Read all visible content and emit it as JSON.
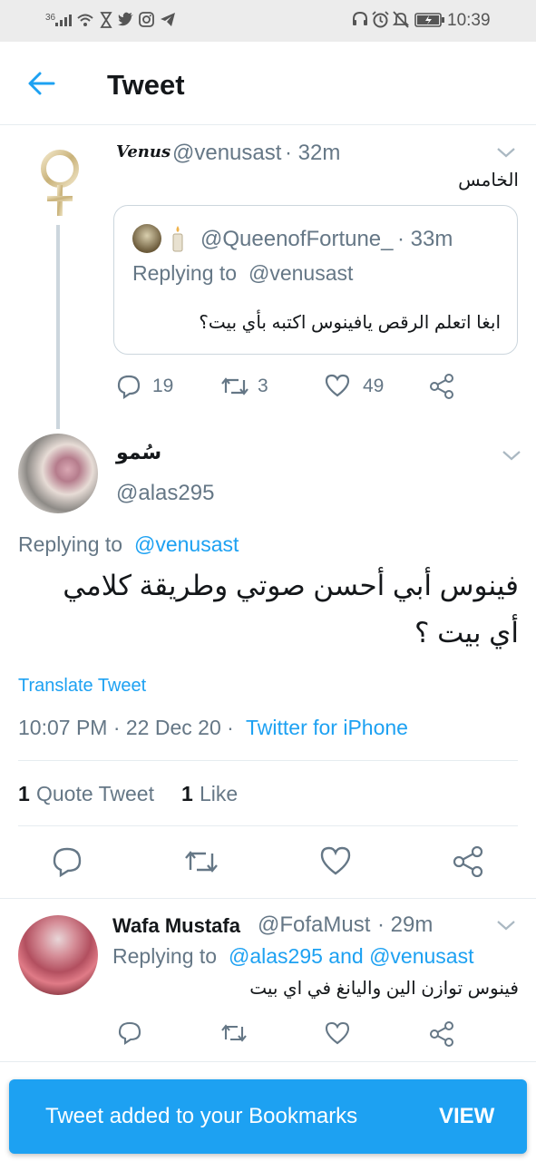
{
  "status_bar": {
    "signal_label": "36",
    "time": "10:39"
  },
  "header": {
    "title": "Tweet"
  },
  "parent_tweet": {
    "display_name": "Venus",
    "handle": "@venusast",
    "time": "· 32m",
    "text": "الخامس",
    "quoted": {
      "handle": "@QueenofFortune_",
      "time": "· 33m",
      "replying_prefix": "Replying to",
      "replying_to": "@venusast",
      "text": "ابغا اتعلم الرقص يافينوس اكتبه بأي بيت؟"
    },
    "reply_count": "19",
    "retweet_count": "3",
    "like_count": "49"
  },
  "main_tweet": {
    "display_name": "سُمو",
    "handle": "@alas295",
    "replying_prefix": "Replying to",
    "replying_to": "@venusast",
    "text_line1": "فينوس أبي أحسن صوتي وطريقة كلامي",
    "text_line2": "أي بيت ؟",
    "translate_label": "Translate Tweet",
    "timestamp": "10:07 PM · 22 Dec 20 ·",
    "source": "Twitter for iPhone",
    "quote_count": "1",
    "quote_label": "Quote Tweet",
    "like_count": "1",
    "like_label": "Like"
  },
  "reply_tweet": {
    "display_name": "Wafa Mustafa",
    "handle": "@FofaMust",
    "time": "· 29m",
    "replying_prefix": "Replying to",
    "replying_to": "@alas295 and @venusast",
    "text": "فينوس توازن الين واليانغ في اي بيت"
  },
  "toast": {
    "message": "Tweet added to your Bookmarks",
    "action": "VIEW"
  },
  "colors": {
    "accent": "#1da1f2",
    "muted": "#657786",
    "toast_bg": "#1da1f2"
  }
}
